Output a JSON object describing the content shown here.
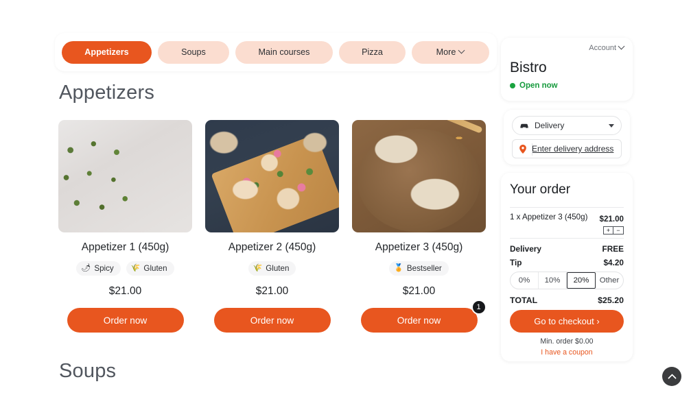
{
  "nav": {
    "categories": [
      {
        "label": "Appetizers",
        "active": true
      },
      {
        "label": "Soups",
        "active": false
      },
      {
        "label": "Main courses",
        "active": false
      },
      {
        "label": "Pizza",
        "active": false
      },
      {
        "label": "More",
        "active": false,
        "has_chevron": true
      }
    ]
  },
  "sections": {
    "appetizers_heading": "Appetizers",
    "soups_heading": "Soups"
  },
  "products": [
    {
      "name": "Appetizer 1 (450g)",
      "price": "$21.00",
      "order_label": "Order now",
      "tags": [
        {
          "label": "Spicy",
          "icon": "chili-pepper-icon",
          "glyph": "🌶"
        },
        {
          "label": "Gluten",
          "icon": "wheat-icon",
          "glyph": "🌾"
        }
      ],
      "qty_badge": null
    },
    {
      "name": "Appetizer 2 (450g)",
      "price": "$21.00",
      "order_label": "Order now",
      "tags": [
        {
          "label": "Gluten",
          "icon": "wheat-icon",
          "glyph": "🌾"
        }
      ],
      "qty_badge": null
    },
    {
      "name": "Appetizer 3 (450g)",
      "price": "$21.00",
      "order_label": "Order now",
      "tags": [
        {
          "label": "Bestseller",
          "icon": "medal-icon",
          "glyph": "🏅"
        }
      ],
      "qty_badge": "1"
    }
  ],
  "store": {
    "account_label": "Account",
    "name": "Bistro",
    "status": "Open now",
    "status_color": "#1aa33f"
  },
  "delivery": {
    "method_label": "Delivery",
    "method_icon": "car-icon",
    "address_placeholder": "Enter delivery address",
    "address_icon": "map-pin-icon"
  },
  "order": {
    "title": "Your order",
    "items": [
      {
        "name": "1 x Appetizer 3 (450g)",
        "price": "$21.00",
        "increase": "+",
        "decrease": "−"
      }
    ],
    "delivery_label": "Delivery",
    "delivery_value": "FREE",
    "tip_label": "Tip",
    "tip_value": "$4.20",
    "tip_options": [
      {
        "label": "0%",
        "selected": false
      },
      {
        "label": "10%",
        "selected": false
      },
      {
        "label": "20%",
        "selected": true
      },
      {
        "label": "Other",
        "selected": false
      }
    ],
    "total_label": "TOTAL",
    "total_value": "$25.20",
    "checkout_label": "Go to checkout ›",
    "min_order": "Min. order $0.00",
    "coupon_label": "I have a coupon"
  },
  "scroll_top": {
    "icon": "chevron-up-icon"
  },
  "colors": {
    "accent": "#e8561f",
    "pill_inactive": "#fbddd0",
    "open_green": "#1aa33f",
    "badge_dark": "#16181b"
  }
}
